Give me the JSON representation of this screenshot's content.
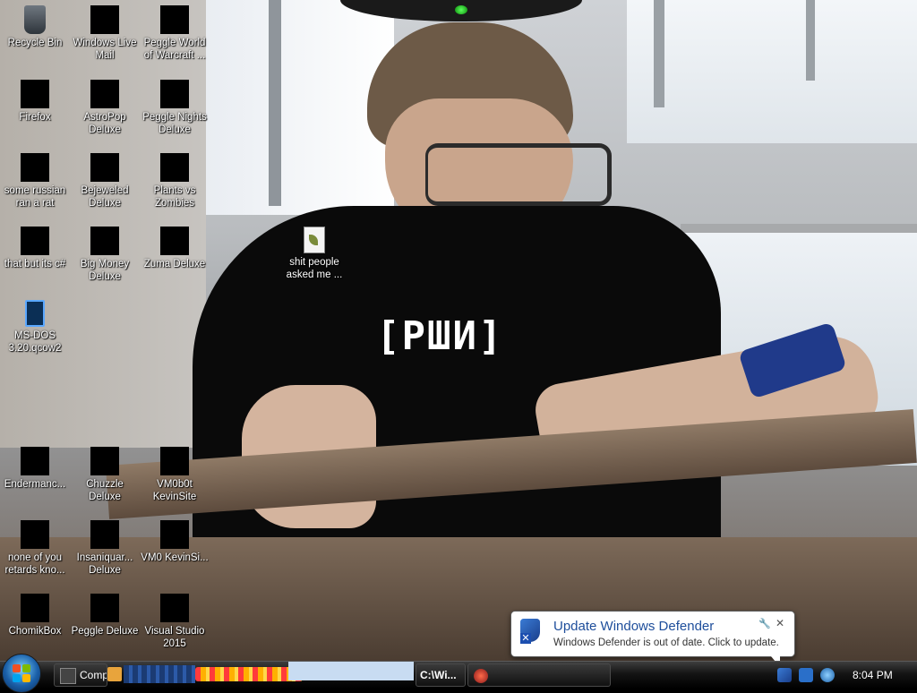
{
  "desktop": {
    "icons": [
      {
        "id": "recycle-bin",
        "label": "Recycle Bin",
        "glyph": "recycle"
      },
      {
        "id": "windows-live-mail",
        "label": "Windows Live Mail",
        "glyph": "black"
      },
      {
        "id": "peggle-world-of-warcraft",
        "label": "Peggle World of Warcraft ...",
        "glyph": "black"
      },
      {
        "id": "firefox",
        "label": "Firefox",
        "glyph": "black"
      },
      {
        "id": "astropop-deluxe",
        "label": "AstroPop Deluxe",
        "glyph": "black"
      },
      {
        "id": "peggle-nights-deluxe",
        "label": "Peggle Nights Deluxe",
        "glyph": "black"
      },
      {
        "id": "some-russian-ran-a-rat",
        "label": "some russian ran a rat",
        "glyph": "black"
      },
      {
        "id": "bejeweled-deluxe",
        "label": "Bejeweled Deluxe",
        "glyph": "black"
      },
      {
        "id": "plants-vs-zombies",
        "label": "Plants vs Zombies",
        "glyph": "black"
      },
      {
        "id": "that-but-its-csharp",
        "label": "that but its c#",
        "glyph": "black"
      },
      {
        "id": "big-money-deluxe",
        "label": "Big Money Deluxe",
        "glyph": "black"
      },
      {
        "id": "zuma-deluxe",
        "label": "Zuma Deluxe",
        "glyph": "black"
      },
      {
        "id": "ms-dos",
        "label": "MS-DOS 3.20.qcow2",
        "glyph": "msdos"
      },
      {
        "id": "shit-people-asked-me",
        "label": "shit people asked me ...",
        "glyph": "file"
      },
      {
        "id": "endermanch",
        "label": "Endermanc...",
        "glyph": "black"
      },
      {
        "id": "chuzzle-deluxe",
        "label": "Chuzzle Deluxe",
        "glyph": "black"
      },
      {
        "id": "vm0b0t-kevinsite",
        "label": "VM0b0t KevinSite",
        "glyph": "black"
      },
      {
        "id": "none-of-you-retards",
        "label": "none of you retards kno...",
        "glyph": "black"
      },
      {
        "id": "insaniquarium-deluxe",
        "label": "Insaniquar... Deluxe",
        "glyph": "black"
      },
      {
        "id": "vm0-kevinsite",
        "label": "VM0 KevinSi...",
        "glyph": "black"
      },
      {
        "id": "chomikbox",
        "label": "ChomikBox",
        "glyph": "black"
      },
      {
        "id": "peggle-deluxe",
        "label": "Peggle Deluxe",
        "glyph": "black"
      },
      {
        "id": "visual-studio-2015",
        "label": "Visual Studio 2015",
        "glyph": "black"
      }
    ],
    "wallpaper_text": "[РШИ]"
  },
  "notification": {
    "title": "Update Windows Defender",
    "body": "Windows Defender is out of date. Click to update.",
    "icon": "windows-defender-shield-icon"
  },
  "taskbar": {
    "buttons": [
      {
        "id": "comp",
        "label": "Comp"
      },
      {
        "id": "cmd",
        "label": "C:\\Wi..."
      }
    ],
    "clock": "8:04 PM",
    "tray_icons": [
      "windows-defender-icon",
      "network-icon",
      "volume-icon"
    ]
  },
  "colors": {
    "balloon_title": "#1e4e9b",
    "taskbar_bg": "#141414",
    "start_orb": "#1a5fa8"
  }
}
